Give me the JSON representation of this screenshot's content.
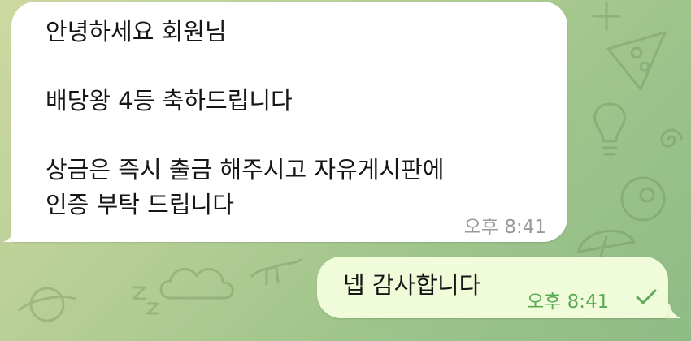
{
  "messages": [
    {
      "direction": "incoming",
      "text": "안녕하세요 회원님\n\n배당왕 4등 축하드립니다\n\n상금은 즉시 출금 해주시고 자유게시판에\n인증 부탁 드립니다",
      "time": "오후 8:41"
    },
    {
      "direction": "outgoing",
      "text": "넵 감사합니다",
      "time": "오후 8:41",
      "status_icon": "check-icon"
    }
  ],
  "colors": {
    "incoming_bubble": "#ffffff",
    "outgoing_bubble": "#f0fcd9",
    "outgoing_time": "#5daa58",
    "incoming_time": "#9a9a9a",
    "background_gradient": [
      "#cdd9a0",
      "#8fbb86"
    ]
  }
}
